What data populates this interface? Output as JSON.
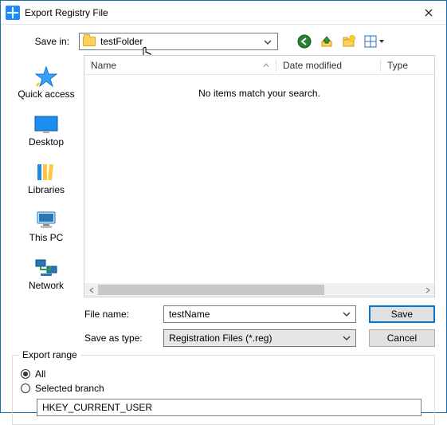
{
  "window": {
    "title": "Export Registry File"
  },
  "savein": {
    "label": "Save in:",
    "folder": "testFolder"
  },
  "nav_icons": {
    "back": "back-icon",
    "up": "up-icon",
    "newfolder": "new-folder-icon",
    "view": "view-menu-icon"
  },
  "places": {
    "quick": "Quick access",
    "desktop": "Desktop",
    "libraries": "Libraries",
    "thispc": "This PC",
    "network": "Network"
  },
  "columns": {
    "name": "Name",
    "date": "Date modified",
    "type": "Type"
  },
  "empty_msg": "No items match your search.",
  "form": {
    "filename_label": "File name:",
    "filename_value": "testName",
    "type_label": "Save as type:",
    "type_value": "Registration Files (*.reg)",
    "save_btn": "Save",
    "cancel_btn": "Cancel"
  },
  "range": {
    "legend": "Export range",
    "all": "All",
    "selected": "Selected branch",
    "branch_value": "HKEY_CURRENT_USER"
  }
}
